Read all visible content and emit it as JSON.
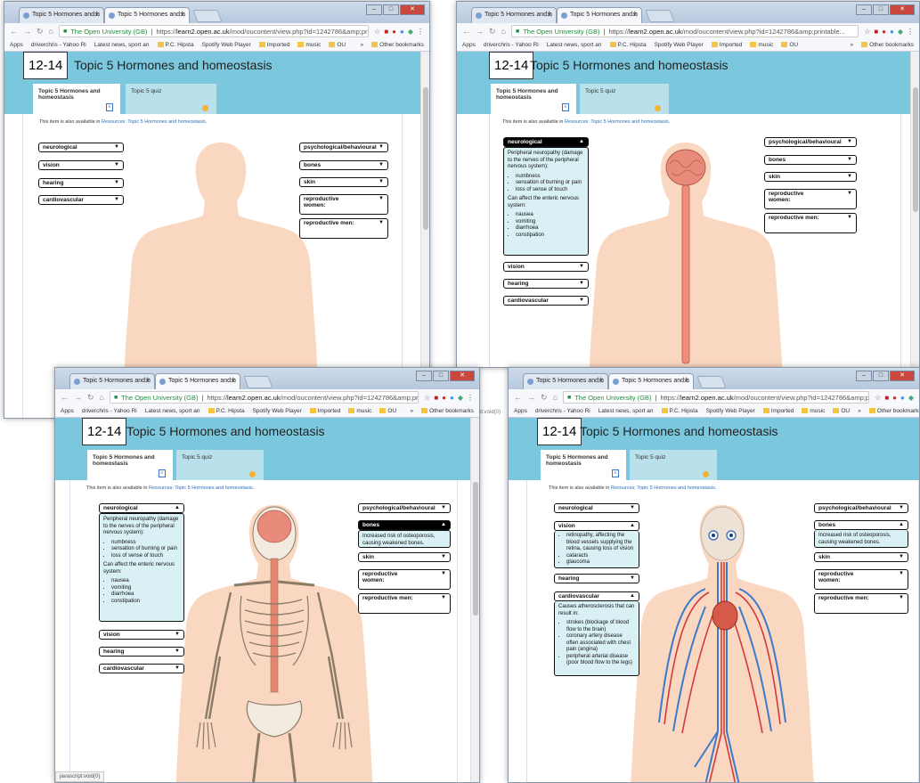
{
  "browser": {
    "tab_title": "Topic 5 Hormones and h",
    "address": {
      "site": "The Open University (GB)",
      "url_prefix": "https://",
      "url_host": "learn2.open.ac.uk",
      "url_path": "/mod/oucontent/view.php?id=1242786&amp;printable..."
    },
    "bookmarks": [
      "Apps",
      "driverchris - Yahoo Ri",
      "Latest news, sport an",
      "P.C. Hipsta",
      "Spotify Web Player",
      "Imported",
      "music",
      "OU",
      "»",
      "Other bookmarks"
    ],
    "status_text": "javascript:void(0)",
    "side_status": "pt:void(0)",
    "window_controls": {
      "min": "–",
      "max": "□",
      "close": "✕"
    }
  },
  "page": {
    "number": "12-14",
    "title": "Topic 5 Hormones and homeostasis",
    "tabs": [
      {
        "label": "Topic 5 Hormones and homeostasis"
      },
      {
        "label": "Topic 5 quiz"
      }
    ],
    "availability_prefix": "This item is also available in ",
    "availability_link": "Resources: Topic 5 Hormones and homeostasis",
    "availability_suffix": "."
  },
  "buttons": {
    "neurological": "neurological",
    "vision": "vision",
    "hearing": "hearing",
    "cardiovascular": "cardiovascular",
    "psych": "psychological/behavioural",
    "bones": "bones",
    "skin": "skin",
    "repro_women": "reproductive women:",
    "repro_men": "reproductive men:",
    "closed_arrow": "▼",
    "open_arrow": "▲"
  },
  "panels": {
    "neurological": {
      "intro": "Peripheral neuropathy (damage to the nerves of the peripheral nervous system):",
      "list1": [
        "numbness",
        "sensation of burning or pain",
        "loss of sense of touch"
      ],
      "mid": "Can affect the enteric nervous system:",
      "list2": [
        "nausea",
        "vomiting",
        "diarrhoea",
        "constipation"
      ]
    },
    "bones": {
      "text": "Increased risk of osteoporosis, causing weakened bones."
    },
    "vision": {
      "list": [
        "retinopathy, affecting the blood vessels supplying the retina, causing loss of vision",
        "cataracts",
        "glaucoma"
      ]
    },
    "cardiovascular": {
      "intro": "Causes atherosclerosis that can result in:",
      "list": [
        "strokes (blockage of blood flow to the brain)",
        "coronary artery disease often associated with chest pain (angina)",
        "peripheral arterial disease (poor blood flow to the legs)"
      ]
    }
  },
  "colors": {
    "header": "#7bc7dd",
    "skin": "#fad7c1",
    "panel": "#d9f0f5"
  }
}
